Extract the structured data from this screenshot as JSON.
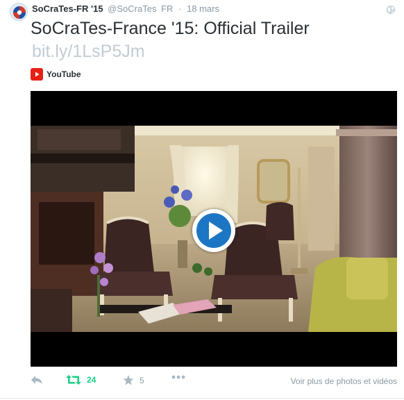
{
  "author": {
    "name": "SoCraTes-FR '15",
    "handle": "@SoCraTes",
    "language": "FR",
    "separator": "·",
    "time": "18 mars"
  },
  "tweet": {
    "title": "SoCraTes-France '15: Official Trailer",
    "link": "bit.ly/1LsP5Jm"
  },
  "media": {
    "source": "YouTube",
    "source_color": "#e62117",
    "play_button_color": "#1d76c4"
  },
  "actions": {
    "retweet_count": "24",
    "favorite_count": "5",
    "more_photos_label": "Voir plus de photos et vidéos",
    "retweet_color": "#19cf86",
    "icon_color": "#aab8c2"
  },
  "icons": {
    "globe": "globe-icon",
    "reply": "reply-icon",
    "retweet": "retweet-icon",
    "favorite": "star-icon",
    "more": "more-dots-icon",
    "play": "play-icon",
    "youtube": "youtube-icon"
  }
}
